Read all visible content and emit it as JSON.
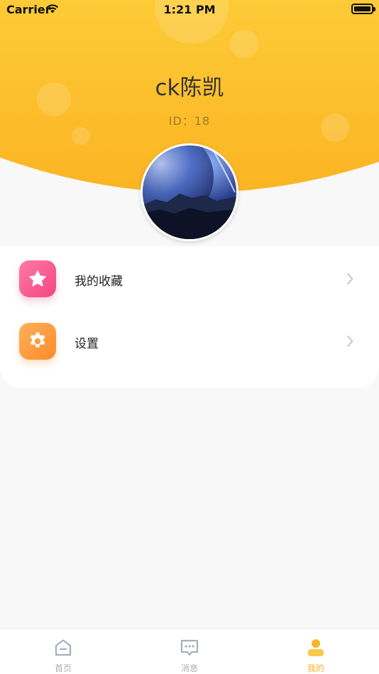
{
  "status_bar": {
    "carrier": "Carrier",
    "time": "1:21 PM",
    "battery_level": 1.0
  },
  "profile": {
    "username": "ck陈凯",
    "id_text": "ID：18"
  },
  "menu": [
    {
      "label": "我的收藏",
      "icon": "star-icon",
      "color": "#f4457f"
    },
    {
      "label": "设置",
      "icon": "gear-icon",
      "color": "#ff8a2a"
    }
  ],
  "tabbar": {
    "items": [
      {
        "label": "首页",
        "icon": "home-icon",
        "active": false
      },
      {
        "label": "消息",
        "icon": "message-icon",
        "active": false
      },
      {
        "label": "我的",
        "icon": "profile-icon",
        "active": true
      }
    ]
  },
  "colors": {
    "header_yellow": "#fcbe2c",
    "active_tab": "#f7b52a",
    "inactive_tab": "#a8aeb8"
  }
}
